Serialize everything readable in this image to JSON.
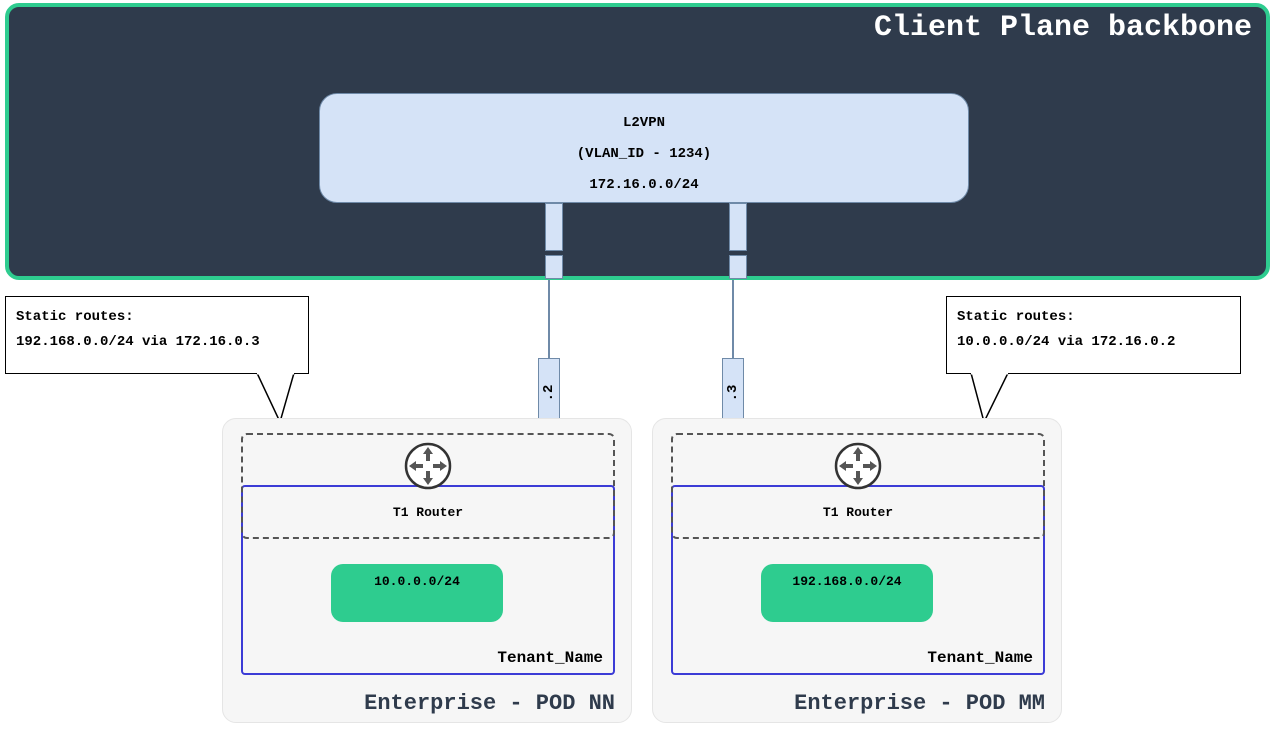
{
  "backbone": {
    "title": "Client Plane backbone",
    "l2vpn": {
      "line1": "L2VPN",
      "line2": "(VLAN_ID - 1234)",
      "line3": "172.16.0.0/24"
    }
  },
  "callouts": {
    "left": {
      "heading": "Static routes:",
      "route": "192.168.0.0/24 via 172.16.0.3"
    },
    "right": {
      "heading": "Static routes:",
      "route": "10.0.0.0/24 via 172.16.0.2"
    }
  },
  "links": {
    "left_ip_suffix": ".2",
    "right_ip_suffix": ".3"
  },
  "pods": {
    "left": {
      "title": "Enterprise - POD NN",
      "t1_label": "T1 Router",
      "tenant_label": "Tenant_Name",
      "subnet": "10.0.0.0/24"
    },
    "right": {
      "title": "Enterprise - POD MM",
      "t1_label": "T1 Router",
      "tenant_label": "Tenant_Name",
      "subnet": "192.168.0.0/24"
    }
  }
}
